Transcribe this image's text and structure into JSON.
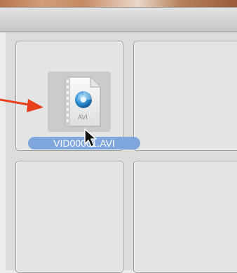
{
  "file": {
    "name": "VID00001.AVI",
    "icon": "avi-video-file-icon",
    "type_badge": "AVI"
  },
  "colors": {
    "selection_label": "#7fa7de",
    "annotation_arrow": "#e8401c"
  },
  "grid": {
    "cells": [
      {
        "name": "cell-1"
      },
      {
        "name": "cell-2"
      },
      {
        "name": "cell-3"
      },
      {
        "name": "cell-4"
      }
    ]
  }
}
